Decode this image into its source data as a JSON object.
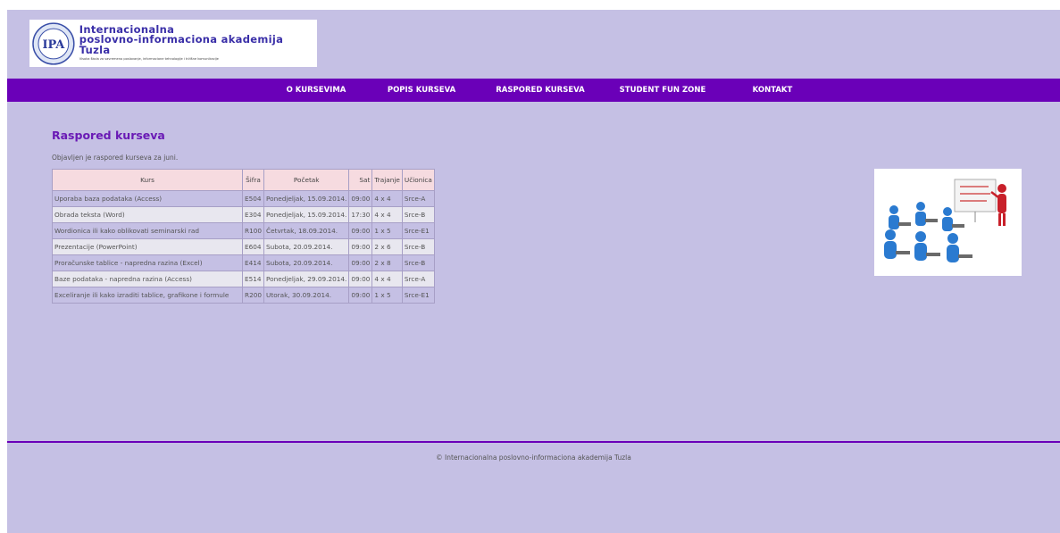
{
  "header": {
    "logo_title_line1": "Internacionalna",
    "logo_title_line2": "poslovno-informaciona akademija Tuzla",
    "logo_subtitle": "Visoka škola za savremeno poslovanje, informacione tehnologije i tržišne komunikacije"
  },
  "nav": {
    "items": [
      {
        "label": "O KURSEVIMA"
      },
      {
        "label": "POPIS KURSEVA"
      },
      {
        "label": "RASPORED KURSEVA"
      },
      {
        "label": "STUDENT FUN ZONE"
      },
      {
        "label": "KONTAKT"
      }
    ]
  },
  "main": {
    "title": "Raspored kurseva",
    "intro": "Objavljen je raspored kurseva za juni.",
    "table": {
      "headers": [
        "Kurs",
        "Šifra",
        "Početak",
        "Sat",
        "Trajanje",
        "Učionica"
      ],
      "rows": [
        [
          "Uporaba baza podataka (Access)",
          "E504",
          "Ponedjeljak, 15.09.2014.",
          "09:00",
          "4 x 4",
          "Srce-A"
        ],
        [
          "Obrada teksta (Word)",
          "E304",
          "Ponedjeljak, 15.09.2014.",
          "17:30",
          "4 x 4",
          "Srce-B"
        ],
        [
          "Wordionica ili kako oblikovati seminarski rad",
          "R100",
          "Četvrtak, 18.09.2014.",
          "09:00",
          "1 x 5",
          "Srce-E1"
        ],
        [
          "Prezentacije (PowerPoint)",
          "E604",
          "Subota, 20.09.2014.",
          "09:00",
          "2 x 6",
          "Srce-B"
        ],
        [
          "Proračunske tablice - napredna razina (Excel)",
          "E414",
          "Subota, 20.09.2014.",
          "09:00",
          "2 x 8",
          "Srce-B"
        ],
        [
          "Baze podataka - napredna razina (Access)",
          "E514",
          "Ponedjeljak, 29.09.2014.",
          "09:00",
          "4 x 4",
          "Srce-A"
        ],
        [
          "Exceliranje ili kako izraditi tablice, grafikone i formule",
          "R200",
          "Utorak, 30.09.2014.",
          "09:00",
          "1 x 5",
          "Srce-E1"
        ]
      ]
    }
  },
  "footer": {
    "copyright": "© Internacionalna poslovno-informaciona akademija Tuzla"
  },
  "colors": {
    "page_background": "#c5c0e4",
    "navbar": "#6a00b8",
    "heading": "#6a1ab5",
    "table_header": "#f6dbe0"
  },
  "icons": {
    "logo": "iipa-seal-logo",
    "illustration": "presentation-illustration"
  }
}
